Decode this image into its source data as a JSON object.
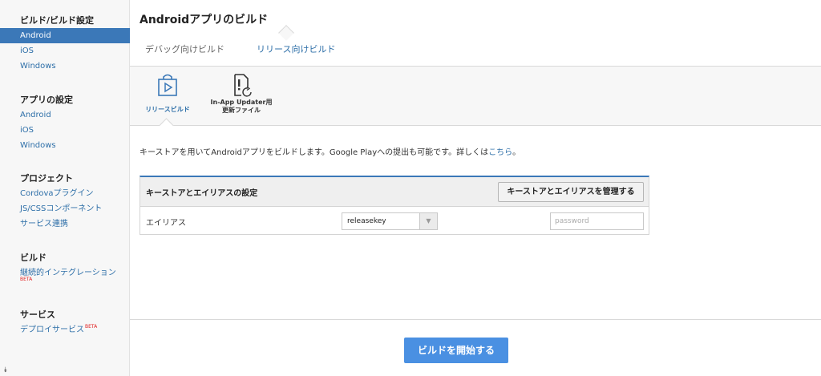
{
  "sidebar": {
    "sections": [
      {
        "header": "ビルド/ビルド設定",
        "items": [
          {
            "label": "Android",
            "active": true
          },
          {
            "label": "iOS"
          },
          {
            "label": "Windows"
          }
        ]
      },
      {
        "header": "アプリの設定",
        "items": [
          {
            "label": "Android"
          },
          {
            "label": "iOS"
          },
          {
            "label": "Windows"
          }
        ]
      },
      {
        "header": "プロジェクト",
        "items": [
          {
            "label": "Cordovaプラグイン"
          },
          {
            "label": "JS/CSSコンポーネント"
          },
          {
            "label": "サービス連携"
          }
        ]
      },
      {
        "header": "ビルド",
        "items": [
          {
            "label": "継続的インテグレーション",
            "badge": "BETA"
          }
        ]
      },
      {
        "header": "サービス",
        "items": [
          {
            "label": "デプロイサービス",
            "badge": "BETA"
          }
        ]
      }
    ],
    "scroll_icon": "⯯"
  },
  "main": {
    "title": "Androidアプリのビルド",
    "tabs": [
      {
        "label": "デバッグ向けビルド"
      },
      {
        "label": "リリース向けビルド",
        "active": true
      }
    ],
    "subtabs": [
      {
        "label": "リリースビルド",
        "icon": "store-bag-icon",
        "active": true
      },
      {
        "label_line1": "In-App Updater用",
        "label_line2": "更新ファイル",
        "icon": "file-update-icon"
      }
    ],
    "description": {
      "text": "キーストアを用いてAndroidアプリをビルドします。Google Playへの提出も可能です。詳しくは",
      "link": "こちら",
      "suffix": "。"
    },
    "keystore_panel": {
      "title": "キーストアとエイリアスの設定",
      "manage_button": "キーストアとエイリアスを管理する",
      "alias_label": "エイリアス",
      "alias_value": "releasekey",
      "password_placeholder": "password"
    },
    "build_button": "ビルドを開始する"
  },
  "colors": {
    "accent": "#3b78b8",
    "link": "#2e6fa8",
    "primary_button": "#4a90e2",
    "beta": "#e02020"
  }
}
